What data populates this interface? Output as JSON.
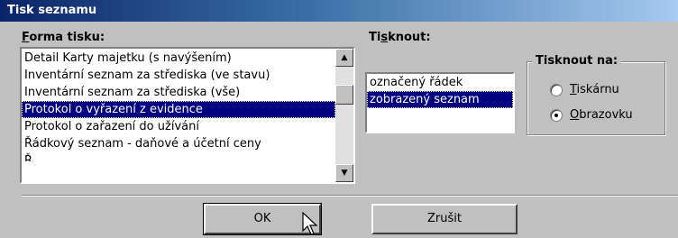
{
  "window": {
    "title": "Tisk seznamu"
  },
  "forma_tisku": {
    "label_accel": "F",
    "label_rest": "orma tisku:",
    "items": [
      "Detail Karty majetku (s navýšením)",
      "Inventární seznam za střediska (ve stavu)",
      "Inventární seznam za střediska (vše)",
      "Protokol o vyřazení z evidence",
      "Protokol o zařazení do užívání",
      "Řádkový seznam - daňové a účetní ceny",
      "Ř"
    ],
    "selected_index": 3
  },
  "tisknout": {
    "label_pre": "Ti",
    "label_accel": "s",
    "label_post": "knout:",
    "items": [
      "označený řádek",
      "zobrazený seznam"
    ],
    "selected_index": 1
  },
  "tisknout_na": {
    "label": "Tisknout na:",
    "options": [
      {
        "accel": "T",
        "rest": "iskárnu",
        "selected": false
      },
      {
        "accel": "O",
        "rest": "brazovku",
        "selected": true
      }
    ]
  },
  "buttons": {
    "ok": "OK",
    "cancel": "Zrušit"
  }
}
